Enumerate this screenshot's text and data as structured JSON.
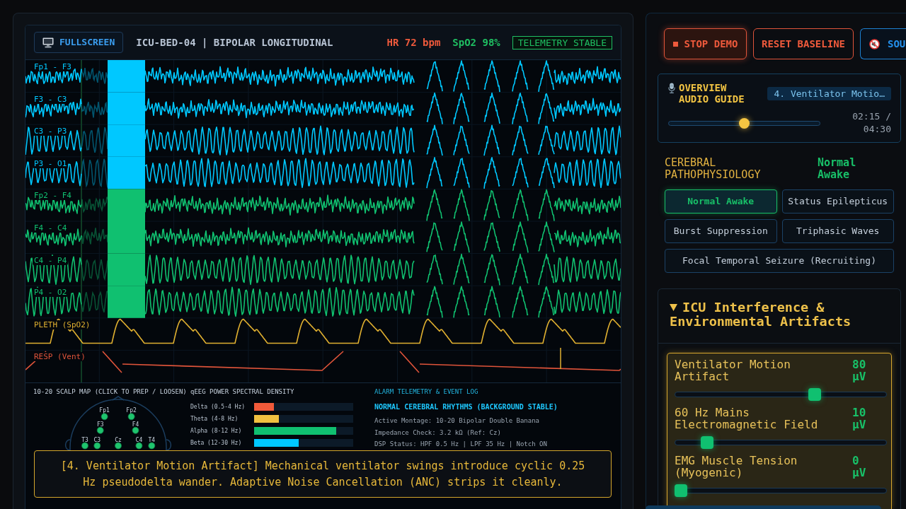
{
  "monitor": {
    "fullscreen_button": "FULLSCREEN",
    "title": "ICU-BED-04 | BIPOLAR LONGITUDINAL",
    "heart_rate": "HR 72 bpm",
    "spo2": "SpO2 98%",
    "status": "TELEMETRY STABLE"
  },
  "channels": [
    {
      "label": "Fp1 - F3",
      "kind": "fast",
      "color": "#00c8ff"
    },
    {
      "label": "F3 - C3",
      "kind": "fast",
      "color": "#00c8ff"
    },
    {
      "label": "C3 - P3",
      "kind": "alpha",
      "color": "#00c8ff"
    },
    {
      "label": "P3 - O1",
      "kind": "alpha",
      "color": "#00c8ff"
    },
    {
      "label": "Fp2 - F4",
      "kind": "fast",
      "color": "#10c070"
    },
    {
      "label": "F4 - C4",
      "kind": "fast",
      "color": "#10c070"
    },
    {
      "label": "C4 - P4",
      "kind": "alpha",
      "color": "#10c070"
    },
    {
      "label": "P4 - O2",
      "kind": "alpha",
      "color": "#10c070"
    },
    {
      "label": "PLETH (SpO2)",
      "kind": "pleth",
      "color": "#e0b030"
    },
    {
      "label": "RESP (Vent)",
      "kind": "resp",
      "color": "#e0543a"
    }
  ],
  "scalp_map": {
    "title": "10-20 SCALP MAP (CLICK TO PREP / LOOSEN)",
    "electrodes": [
      {
        "label": "Fp1"
      },
      {
        "label": "Fp2"
      },
      {
        "label": "F3"
      },
      {
        "label": "F4"
      },
      {
        "label": "T3"
      },
      {
        "label": "C3"
      },
      {
        "label": "Cz"
      },
      {
        "label": "C4"
      },
      {
        "label": "T4"
      }
    ]
  },
  "spectral_density": {
    "title": "qEEG POWER SPECTRAL DENSITY",
    "bands": [
      {
        "label": "Delta (0.5-4 Hz)",
        "level": 0.2,
        "color": "#f05a3a"
      },
      {
        "label": "Theta (4-8 Hz)",
        "level": 0.25,
        "color": "#f0c040"
      },
      {
        "label": "Alpha (8-12 Hz)",
        "level": 0.83,
        "color": "#10c070"
      },
      {
        "label": "Beta (12-30 Hz)",
        "level": 0.45,
        "color": "#00c8ff"
      }
    ]
  },
  "event_log": {
    "title": "ALARM TELEMETRY & EVENT LOG",
    "headline": "NORMAL CEREBRAL RHYTHMS (BACKGROUND STABLE)",
    "lines": [
      "Active Montage: 10-20 Bipolar Double Banana",
      "Impedance Check: 3.2 kΩ (Ref: Cz)",
      "DSP Status: HPF 0.5 Hz | LPF 35 Hz | Notch ON"
    ]
  },
  "caption": "[4. Ventilator Motion Artifact] Mechanical ventilator swings introduce cyclic 0.25 Hz pseudodelta wander. Adaptive Noise Cancellation (ANC) strips it cleanly.",
  "controls": [
    {
      "label": "STOP DEMO",
      "kind": "stop"
    },
    {
      "label": "RESET BASELINE",
      "kind": "reset"
    },
    {
      "label": "SOU",
      "kind": "sound"
    }
  ],
  "audio_guide": {
    "title": "OVERVIEW AUDIO GUIDE",
    "track": "4. Ventilator Motio…",
    "level": 0.5,
    "time": "02:15 / 04:30"
  },
  "pathophysiology": {
    "title": "CEREBRAL PATHOPHYSIOLOGY",
    "current": "Normal Awake",
    "options": [
      {
        "label": "Normal Awake",
        "selected": true
      },
      {
        "label": "Status Epilepticus",
        "selected": false
      },
      {
        "label": "Burst Suppression",
        "selected": false
      },
      {
        "label": "Triphasic Waves",
        "selected": false
      },
      {
        "label": "Focal Temporal Seizure (Recruiting)",
        "selected": false
      }
    ]
  },
  "artifacts": {
    "title": "ICU Interference & Environmental Artifacts",
    "expanded": true,
    "sliders": [
      {
        "label": "Ventilator Motion Artifact",
        "value": "80 µV",
        "level": 0.67
      },
      {
        "label": "60 Hz Mains Electromagnetic Field",
        "value": "10 µV",
        "level": 0.13
      },
      {
        "label": "EMG Muscle Tension (Myogenic)",
        "value": "0 µV",
        "level": 0
      }
    ]
  }
}
